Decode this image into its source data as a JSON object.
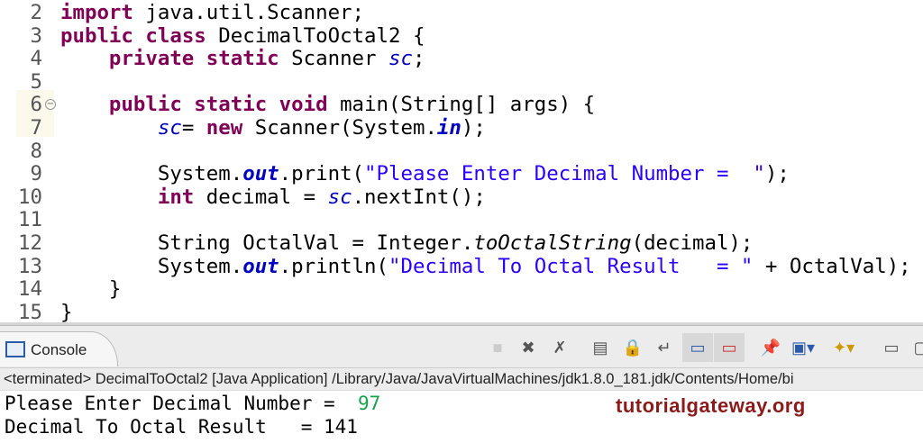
{
  "editor": {
    "lines": [
      {
        "n": "2",
        "t": [
          [
            "kw",
            "import"
          ],
          [
            "",
            "  java.util.Scanner;"
          ]
        ]
      },
      {
        "n": "3",
        "t": [
          [
            "kw",
            "public"
          ],
          [
            "",
            " "
          ],
          [
            "kw",
            "class"
          ],
          [
            "",
            " DecimalToOctal2 {"
          ]
        ]
      },
      {
        "n": "4",
        "t": [
          [
            "",
            "    "
          ],
          [
            "kw",
            "private"
          ],
          [
            "",
            " "
          ],
          [
            "kw",
            "static"
          ],
          [
            "",
            " Scanner "
          ],
          [
            "fld",
            "sc"
          ],
          [
            "",
            ";"
          ]
        ]
      },
      {
        "n": "5",
        "t": []
      },
      {
        "n": "6",
        "t": [
          [
            "",
            "    "
          ],
          [
            "kw",
            "public"
          ],
          [
            "",
            " "
          ],
          [
            "kw",
            "static"
          ],
          [
            "",
            " "
          ],
          [
            "kw",
            "void"
          ],
          [
            "",
            " main(String[] args) {"
          ]
        ],
        "fold": "⊖"
      },
      {
        "n": "7",
        "t": [
          [
            "",
            "        "
          ],
          [
            "fld",
            "sc"
          ],
          [
            "",
            "= "
          ],
          [
            "kw",
            "new"
          ],
          [
            "",
            " Scanner(System."
          ],
          [
            "sfld",
            "in"
          ],
          [
            "",
            ");"
          ]
        ]
      },
      {
        "n": "8",
        "t": []
      },
      {
        "n": "9",
        "t": [
          [
            "",
            "        System."
          ],
          [
            "sfld",
            "out"
          ],
          [
            "",
            ".print("
          ],
          [
            "str",
            "\"Please Enter Decimal Number =  \""
          ],
          [
            "",
            ");"
          ]
        ]
      },
      {
        "n": "10",
        "t": [
          [
            "",
            "        "
          ],
          [
            "kw",
            "int"
          ],
          [
            "",
            " decimal = "
          ],
          [
            "fld",
            "sc"
          ],
          [
            "",
            ".nextInt();"
          ]
        ]
      },
      {
        "n": "11",
        "t": []
      },
      {
        "n": "12",
        "t": [
          [
            "",
            "        String OctalVal = Integer."
          ],
          [
            "sm",
            "toOctalString"
          ],
          [
            "",
            "(decimal);"
          ]
        ]
      },
      {
        "n": "13",
        "t": [
          [
            "",
            "        System."
          ],
          [
            "sfld",
            "out"
          ],
          [
            "",
            ".println("
          ],
          [
            "str",
            "\"Decimal To Octal Result   = \""
          ],
          [
            "",
            " + OctalVal);"
          ]
        ]
      },
      {
        "n": "14",
        "t": [
          [
            "",
            "    }"
          ]
        ]
      },
      {
        "n": "15",
        "t": [
          [
            "",
            "}"
          ]
        ]
      }
    ]
  },
  "console": {
    "tab_label": "Console",
    "path": "<terminated> DecimalToOctal2 [Java Application] /Library/Java/JavaVirtualMachines/jdk1.8.0_181.jdk/Contents/Home/bi",
    "output": {
      "line1_prompt": "Please Enter Decimal Number =  ",
      "line1_input": "97",
      "line2": "Decimal To Octal Result   = 141"
    }
  },
  "watermark": "tutorialgateway.org",
  "colors": {
    "keyword": "#7f0055",
    "string": "#2a00ff",
    "field": "#0000c0",
    "input": "#17a14b",
    "watermark": "#8b1a1a"
  }
}
